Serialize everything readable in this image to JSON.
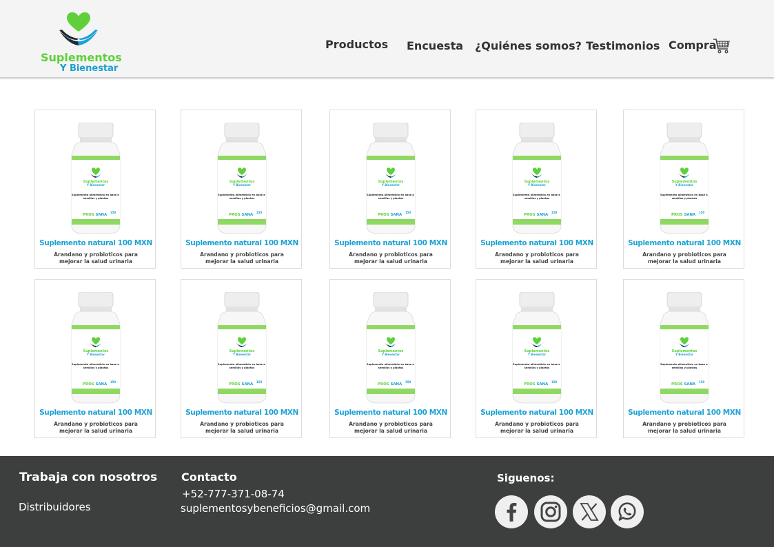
{
  "header": {
    "logo": {
      "line1": "Suplementos",
      "line2": "Y Bienestar"
    },
    "nav": [
      {
        "label": "Productos"
      },
      {
        "label": "Encuesta"
      },
      {
        "label": "¿Quiénes somos?"
      },
      {
        "label": "Testimonios"
      },
      {
        "label": "Compra"
      }
    ]
  },
  "products": [
    {
      "title": "Suplemento natural 100 MXN",
      "description": "Arandano y probioticos para mejorar la salud urinaria"
    },
    {
      "title": "Suplemento natural 100 MXN",
      "description": "Arandano y probioticos para mejorar la salud urinaria"
    },
    {
      "title": "Suplemento natural 100 MXN",
      "description": "Arandano y probioticos para mejorar la salud urinaria"
    },
    {
      "title": "Suplemento natural 100 MXN",
      "description": "Arandano y probioticos para mejorar la salud urinaria"
    },
    {
      "title": "Suplemento natural 100 MXN",
      "description": "Arandano y probioticos para mejorar la salud urinaria"
    },
    {
      "title": "Suplemento natural 100 MXN",
      "description": "Arandano y probioticos para mejorar la salud urinaria"
    },
    {
      "title": "Suplemento natural 100 MXN",
      "description": "Arandano y probioticos para mejorar la salud urinaria"
    },
    {
      "title": "Suplemento natural 100 MXN",
      "description": "Arandano y probioticos para mejorar la salud urinaria"
    },
    {
      "title": "Suplemento natural 100 MXN",
      "description": "Arandano y probioticos para mejorar la salud urinaria"
    },
    {
      "title": "Suplemento natural 100 MXN",
      "description": "Arandano y probioticos para mejorar la salud urinaria"
    }
  ],
  "bottle_label": {
    "brand1": "Suplementos",
    "brand2": "Y Bienestar",
    "text": "Suplemento alimenticio en base a semillas y plantas",
    "pros": "PROS",
    "sana": "SANA",
    "count": "150"
  },
  "footer": {
    "work_title": "Trabaja con nosotros",
    "distributors": "Distribuidores",
    "contact_title": "Contacto",
    "phone": "+52-777-371-08-74",
    "email": "suplementosybeneficios@gmail.com",
    "follow_title": "Siguenos:",
    "social": [
      "facebook-icon",
      "instagram-icon",
      "x-icon",
      "whatsapp-icon"
    ]
  },
  "colors": {
    "green": "#5fd03a",
    "blue": "#1ea2d4",
    "footer_bg": "#3d3e3e"
  }
}
